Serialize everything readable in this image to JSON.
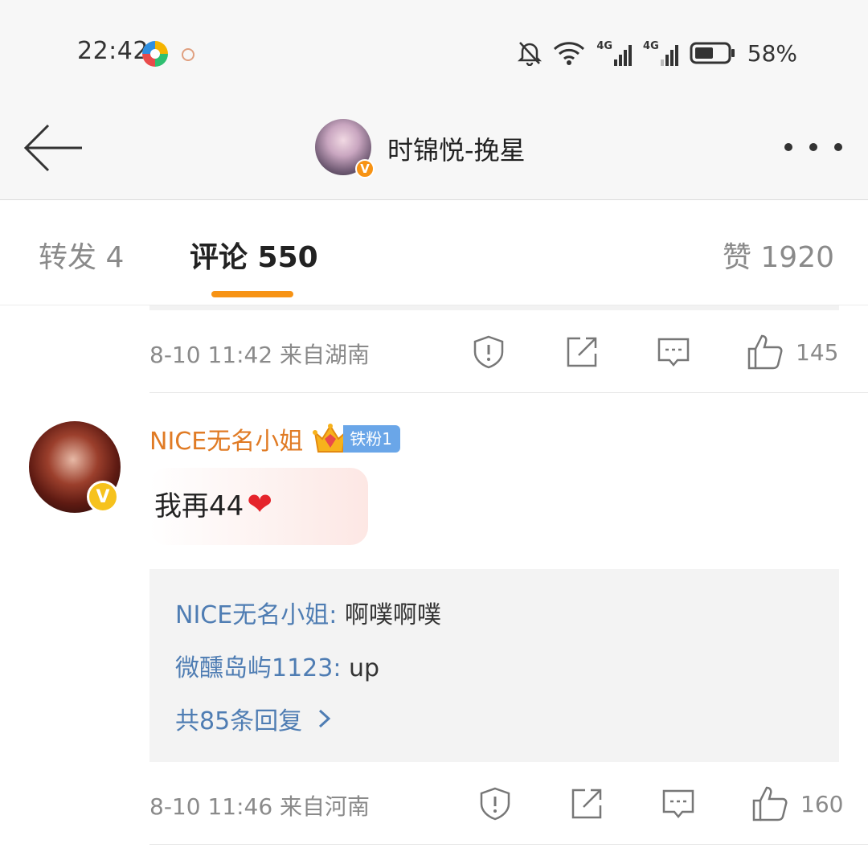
{
  "status_bar": {
    "time": "22:42",
    "battery_percent": "58%",
    "network_labels": [
      "4G",
      "4G"
    ]
  },
  "header": {
    "title": "时锦悦-挽星",
    "verified_mark": "V"
  },
  "tabs": [
    {
      "label": "转发 4",
      "active": false
    },
    {
      "label": "评论 550",
      "active": true
    },
    {
      "label": "赞 1920",
      "active": false
    }
  ],
  "comments": [
    {
      "meta": {
        "time_location": "8-10 11:42 来自湖南",
        "like_count": "145"
      }
    },
    {
      "username": "NICE无名小姐",
      "fan_badge": "铁粉1",
      "verified_mark": "V",
      "text": "我再44",
      "emoji": "❤",
      "replies": [
        {
          "name": "NICE无名小姐",
          "content": "啊噗啊噗"
        },
        {
          "name": "微醺岛屿1123",
          "content": "up"
        }
      ],
      "more_replies": "共85条回复",
      "meta": {
        "time_location": "8-10 11:46 来自河南",
        "like_count": "160"
      }
    }
  ],
  "colors": {
    "accent": "#f79314",
    "username": "#e07b25",
    "reply_link": "#4f7db3",
    "fan_badge": "#6aa6e8"
  }
}
